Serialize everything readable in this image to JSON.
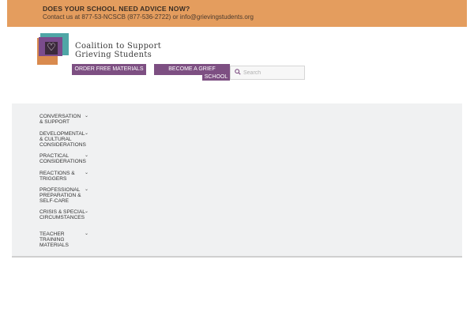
{
  "topbar": {
    "headline": "DOES YOUR SCHOOL NEED ADVICE NOW?",
    "contact": "Contact us at 877-53-NCSCB (877-536-2722) or  info@grievingstudents.org"
  },
  "brand": {
    "line1": "Coalition to Support",
    "line2": "Grieving Students"
  },
  "nav": {
    "free_materials": "ORDER FREE MATERIALS",
    "grief_sensitive_line1": "BECOME A GRIEF SENSITIVE",
    "grief_sensitive_line2": "SCHOOL"
  },
  "search": {
    "placeholder": "Search"
  },
  "menu": [
    {
      "label": "CONVERSATION & SUPPORT"
    },
    {
      "label": "DEVELOPMENTAL & CULTURAL CONSIDERATIONS"
    },
    {
      "label": "PRACTICAL CONSIDERATIONS"
    },
    {
      "label": "REACTIONS & TRIGGERS"
    },
    {
      "label": "PROFESSIONAL PREPARATION & SELF-CARE"
    },
    {
      "label": "CRISIS & SPECIAL CIRCUMSTANCES"
    },
    {
      "label": "TEACHER TRAINING MATERIALS"
    }
  ],
  "colors": {
    "topbar": "#e49d5e",
    "button": "#7d4f82",
    "panel": "#f0f1f2"
  }
}
